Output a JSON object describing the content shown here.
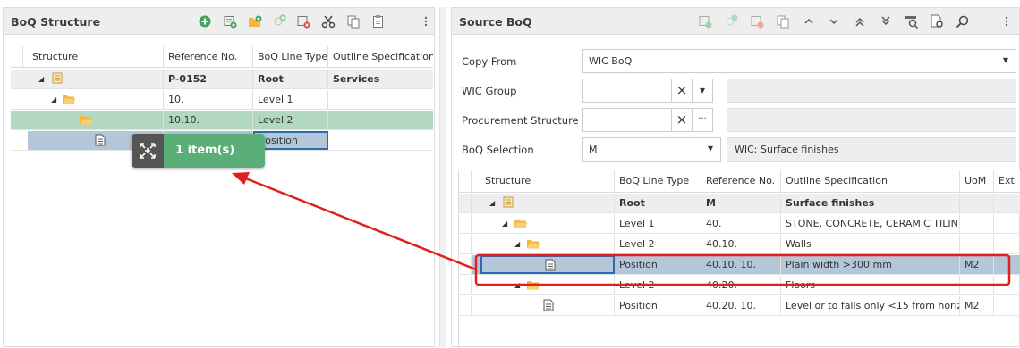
{
  "left": {
    "title": "BoQ Structure",
    "columns": [
      "Structure",
      "Reference No.",
      "BoQ Line Type",
      "Outline Specification"
    ],
    "rows": [
      {
        "ref": "P-0152",
        "type": "Root",
        "spec": "Services"
      },
      {
        "ref": "10.",
        "type": "Level 1",
        "spec": ""
      },
      {
        "ref": "10.10.",
        "type": "Level 2",
        "spec": ""
      },
      {
        "ref": "",
        "type": "Position",
        "spec": ""
      }
    ],
    "drag_label": "1 item(s)",
    "toolbar_icons": [
      "add-circle-icon",
      "new-record-icon",
      "new-folder-icon",
      "new-sub-icon",
      "delete-record-icon",
      "cut-icon",
      "copy-icon",
      "paste-icon",
      "more-icon"
    ]
  },
  "right": {
    "title": "Source BoQ",
    "toolbar_icons": [
      "new-record-icon",
      "new-sub-icon",
      "delete-record-icon",
      "copy-icon",
      "chevron-up-icon",
      "chevron-down-icon",
      "double-up-icon",
      "double-down-icon",
      "filter-icon",
      "settings-icon",
      "search-icon",
      "more-icon"
    ],
    "form": {
      "copy_from_label": "Copy From",
      "copy_from_value": "WIC BoQ",
      "wic_group_label": "WIC Group",
      "procurement_label": "Procurement Structure",
      "boq_selection_label": "BoQ Selection",
      "boq_selection_value": "M",
      "boq_selection_desc": "WIC: Surface finishes",
      "clear_symbol": "×",
      "dropdown_symbol": "▾",
      "ellipsis_symbol": "···"
    },
    "columns": [
      "Structure",
      "BoQ Line Type",
      "Reference No.",
      "Outline Specification",
      "UoM",
      "Ext"
    ],
    "rows": [
      {
        "type": "Root",
        "ref": "M",
        "spec": "Surface finishes",
        "uom": ""
      },
      {
        "type": "Level 1",
        "ref": "40.",
        "spec": "STONE, CONCRETE, CERAMIC TILIN...",
        "uom": ""
      },
      {
        "type": "Level 2",
        "ref": "40.10.",
        "spec": "Walls",
        "uom": ""
      },
      {
        "type": "Position",
        "ref": "40.10. 10.",
        "spec": "Plain width >300 mm",
        "uom": "M2"
      },
      {
        "type": "Level 2",
        "ref": "40.20.",
        "spec": "Floors",
        "uom": ""
      },
      {
        "type": "Position",
        "ref": "40.20. 10.",
        "spec": "Level or to falls only <15 from horiz...",
        "uom": "M2"
      }
    ]
  },
  "colors": {
    "selected_row": "#b3c7d8",
    "level2_row": "#b2d8c2",
    "drag_badge": "#5aaf79",
    "arrow": "#e0201f",
    "folder": "#f4b63f"
  }
}
